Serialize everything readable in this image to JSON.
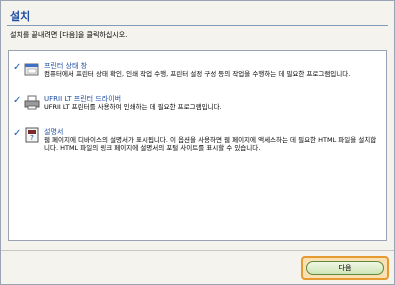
{
  "header": {
    "title": "설치",
    "instruction": "설치를 끝내려면 [다음]을 클릭하십시오."
  },
  "items": [
    {
      "title": "프린터 상태 창",
      "description": "컴퓨터에서 프린터 상태 확인, 인쇄 작업 수행, 프린터 설정 구성 등의 작업을 수행하는 데 필요한 프로그램입니다.",
      "icon": "status-window-icon"
    },
    {
      "title": "UFRII LT 프린터 드라이버",
      "description": "UFRII LT 프린터를 사용하여 인쇄하는 데 필요한 프로그램입니다.",
      "icon": "printer-icon"
    },
    {
      "title": "설명서",
      "description": "웹 페이지에 디바이스의 설명서가 표시됩니다. 이 옵션을 사용하면 웹 페이지에 액세스하는 데 필요한 HTML 파일을 설치합니다. HTML 파일의 링크 페이지에 설명서의 포털 사이트를 표시할 수 있습니다.",
      "icon": "manual-icon"
    }
  ],
  "footer": {
    "next_label": "다음"
  },
  "colors": {
    "accent": "#1e4fa3",
    "check": "#1c5fb0",
    "focus": "#e59a32"
  }
}
